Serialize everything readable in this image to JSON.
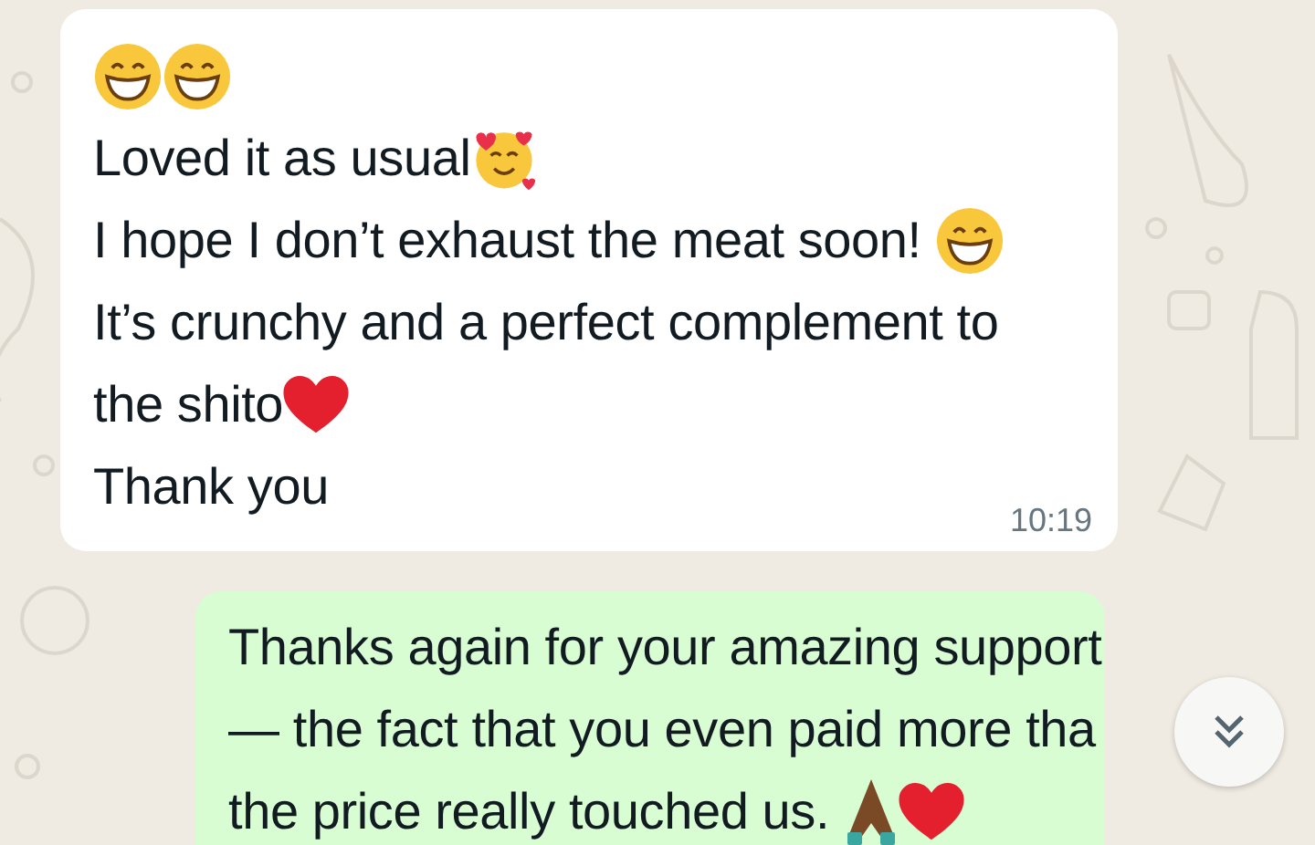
{
  "messages": [
    {
      "kind": "incoming",
      "time": "10:19",
      "lines": [
        {
          "parts": [
            {
              "kind": "grin"
            },
            {
              "kind": "grin"
            }
          ]
        },
        {
          "parts": [
            {
              "kind": "text",
              "text": "Loved it as usual"
            },
            {
              "kind": "smiling-hearts"
            }
          ]
        },
        {
          "parts": [
            {
              "kind": "text",
              "text": "I hope I don’t exhaust the meat soon! "
            },
            {
              "kind": "grin"
            }
          ]
        },
        {
          "parts": [
            {
              "kind": "text",
              "text": "It’s crunchy and a perfect complement to"
            }
          ]
        },
        {
          "parts": [
            {
              "kind": "text",
              "text": "the shito"
            },
            {
              "kind": "heart"
            }
          ]
        },
        {
          "parts": [
            {
              "kind": "text",
              "text": "Thank you"
            }
          ]
        }
      ]
    },
    {
      "kind": "outgoing",
      "lines": [
        {
          "parts": [
            {
              "kind": "text",
              "text": "Thanks again for your amazing support"
            }
          ]
        },
        {
          "parts": [
            {
              "kind": "text",
              "text": "— the fact that you even paid more tha"
            }
          ]
        },
        {
          "parts": [
            {
              "kind": "text",
              "text": "the price really touched us. "
            },
            {
              "kind": "pray"
            },
            {
              "kind": "heart"
            }
          ]
        }
      ]
    }
  ]
}
